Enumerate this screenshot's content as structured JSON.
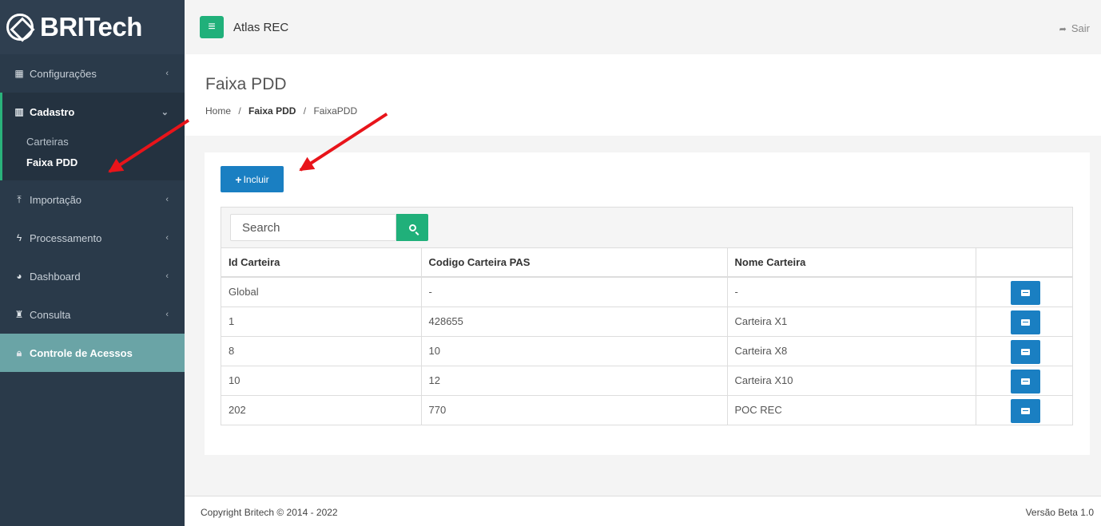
{
  "brand": {
    "name": "BRITech"
  },
  "sidebar": {
    "items": [
      {
        "label": "Configurações",
        "icon": "grid-icon"
      },
      {
        "label": "Cadastro",
        "icon": "bar-chart-icon"
      },
      {
        "label": "Importação",
        "icon": "upload-icon"
      },
      {
        "label": "Processamento",
        "icon": "bolt-icon"
      },
      {
        "label": "Dashboard",
        "icon": "pie-icon"
      },
      {
        "label": "Consulta",
        "icon": "binoculars-icon"
      },
      {
        "label": "Controle de Acessos",
        "icon": "lock-icon"
      }
    ],
    "submenu": [
      {
        "label": "Carteiras"
      },
      {
        "label": "Faixa PDD"
      }
    ]
  },
  "topbar": {
    "app_title": "Atlas REC",
    "logout_label": "Sair"
  },
  "header": {
    "title": "Faixa PDD",
    "breadcrumb": {
      "home": "Home",
      "section": "Faixa PDD",
      "current": "FaixaPDD",
      "separator": "/"
    }
  },
  "toolbar": {
    "add_label": "Incluir"
  },
  "search": {
    "placeholder": "Search"
  },
  "table": {
    "headers": [
      "Id Carteira",
      "Codigo Carteira PAS",
      "Nome Carteira",
      ""
    ],
    "rows": [
      {
        "id": "Global",
        "codigo": "-",
        "nome": "-"
      },
      {
        "id": "1",
        "codigo": "428655",
        "nome": "Carteira X1"
      },
      {
        "id": "8",
        "codigo": "10",
        "nome": "Carteira X8"
      },
      {
        "id": "10",
        "codigo": "12",
        "nome": "Carteira X10"
      },
      {
        "id": "202",
        "codigo": "770",
        "nome": "POC REC"
      }
    ]
  },
  "footer": {
    "copyright": "Copyright Britech © 2014 - 2022",
    "version": "Versão Beta 1.0"
  },
  "colors": {
    "sidebar": "#2a3a4a",
    "accent_green": "#20b07a",
    "primary_blue": "#1a7fc2",
    "access_teal": "#6aa4a6",
    "annotation_red": "#e8141a"
  }
}
